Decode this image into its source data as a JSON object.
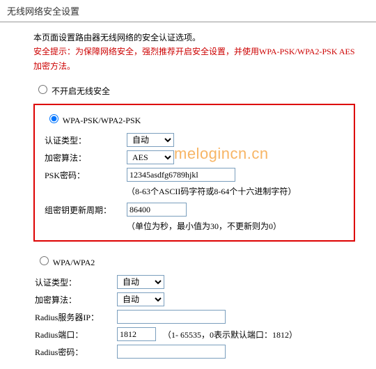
{
  "pageTitle": "无线网络安全设置",
  "intro": {
    "line1_black": "本页面设置路由器无线网络的安全认证选项。",
    "line2": "安全提示：为保障网络安全，强烈推荐开启安全设置，并使用WPA-PSK/WPA2-PSK AES加密方法。"
  },
  "radios": {
    "disable": "不开启无线安全",
    "wpapsk": "WPA-PSK/WPA2-PSK",
    "wpa": "WPA/WPA2"
  },
  "labels": {
    "authType": "认证类型：",
    "encAlg": "加密算法：",
    "pskKey": "PSK密码：",
    "groupRekey": "组密钥更新周期：",
    "radiusIp": "Radius服务器IP：",
    "radiusPort": "Radius端口：",
    "radiusKey": "Radius密码："
  },
  "values": {
    "authType1": "自动",
    "encAlg1": "AES",
    "pskKey": "12345asdfg6789hjkl",
    "groupRekey": "86400",
    "authType2": "自动",
    "encAlg2": "自动",
    "radiusIp": "",
    "radiusPort": "1812",
    "radiusKey": ""
  },
  "hints": {
    "pskHint": "（8-63个ASCII码字符或8-64个十六进制字符）",
    "rekeyHint": "（单位为秒，最小值为30，不更新则为0）",
    "portHint": "（1- 65535，0表示默认端口：1812）"
  },
  "watermark": "melogincn.cn"
}
